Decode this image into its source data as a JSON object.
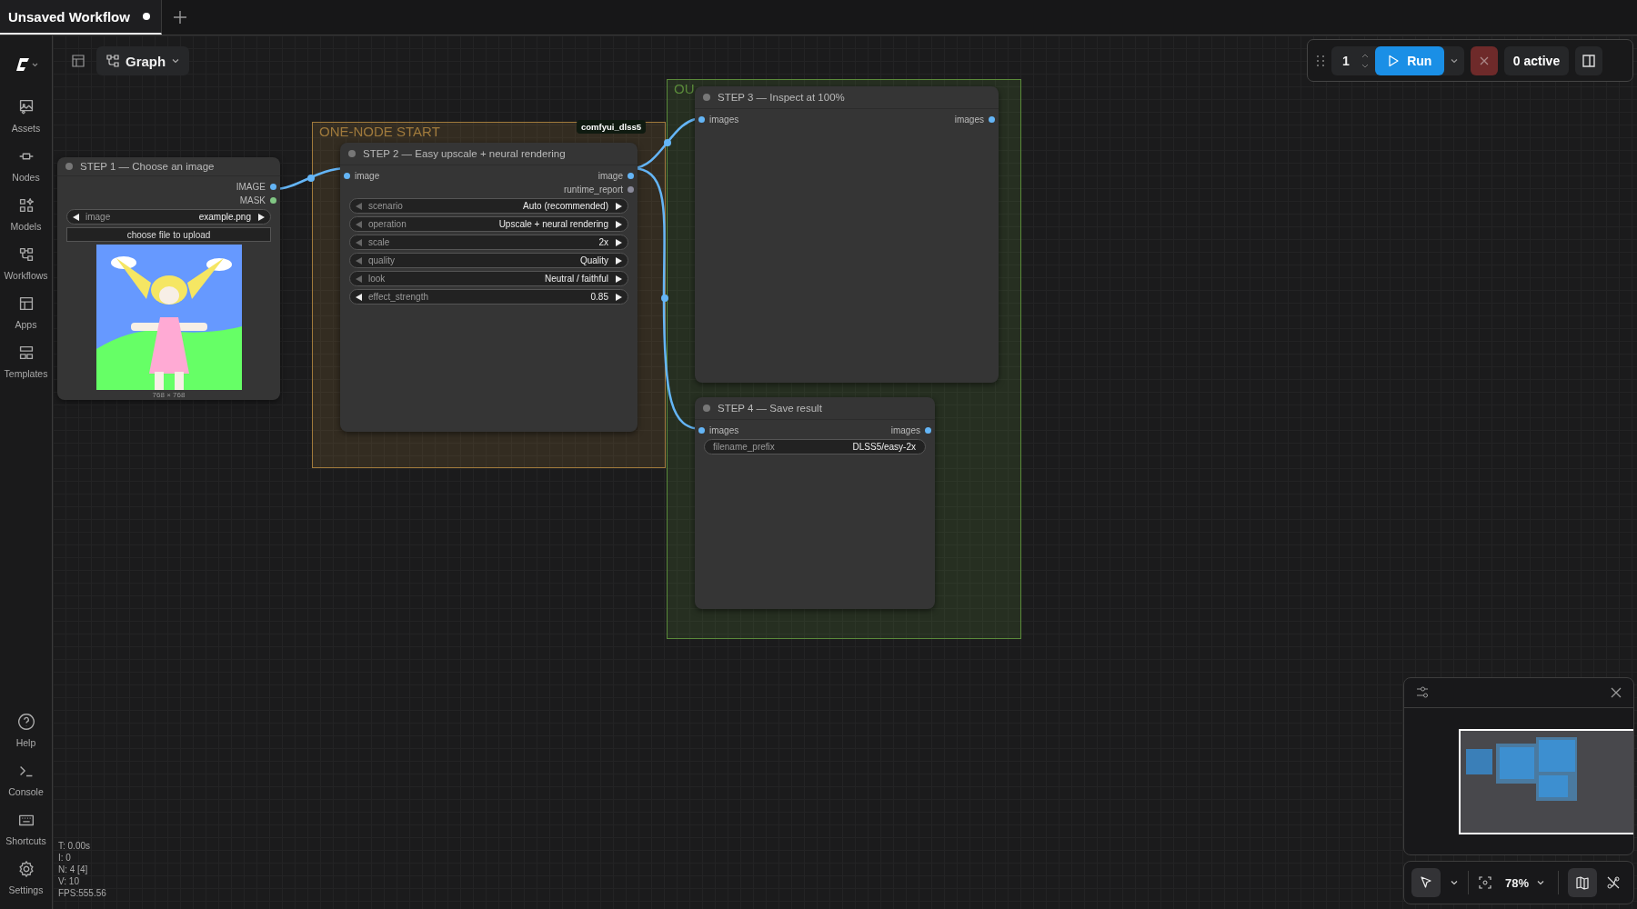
{
  "tabs": [
    {
      "label": "Unsaved Workflow",
      "selected": true,
      "modified": true
    }
  ],
  "sidebar": {
    "top": [
      {
        "label": "Assets"
      },
      {
        "label": "Nodes"
      },
      {
        "label": "Models"
      },
      {
        "label": "Workflows"
      },
      {
        "label": "Apps"
      },
      {
        "label": "Templates"
      }
    ],
    "bottom": [
      {
        "label": "Help"
      },
      {
        "label": "Console"
      },
      {
        "label": "Shortcuts"
      },
      {
        "label": "Settings"
      }
    ]
  },
  "view_button": {
    "label": "Graph"
  },
  "run_toolbar": {
    "batch_count": "1",
    "run_label": "Run",
    "active_count": "0 active"
  },
  "groups": [
    {
      "title": "ONE-NODE START",
      "color": "#a07a3c"
    },
    {
      "title": "OU",
      "color": "#5a8a3a"
    }
  ],
  "nodes": [
    {
      "title": "STEP 1 — Choose an image",
      "outputs": [
        {
          "label": "IMAGE",
          "color": "#64b5f6"
        },
        {
          "label": "MASK",
          "color": "#81c784"
        }
      ],
      "widgets": [
        {
          "kind": "combo",
          "name": "image",
          "value": "example.png",
          "prev_disabled": false
        }
      ],
      "upload_button": "choose file to upload",
      "preview": {
        "kind": "picture",
        "caption": "768 × 768"
      }
    },
    {
      "title": "STEP 2 — Easy upscale + neural rendering",
      "badge": "comfyui_dlss5",
      "inputs": [
        {
          "label": "image",
          "color": "#64b5f6"
        }
      ],
      "outputs": [
        {
          "label": "image",
          "color": "#64b5f6"
        },
        {
          "label": "runtime_report",
          "color": "#8a8a9a"
        }
      ],
      "widgets": [
        {
          "kind": "combo",
          "name": "scenario",
          "value": "Auto (recommended)",
          "prev_disabled": true
        },
        {
          "kind": "combo",
          "name": "operation",
          "value": "Upscale + neural rendering",
          "prev_disabled": true
        },
        {
          "kind": "combo",
          "name": "scale",
          "value": "2x",
          "prev_disabled": true
        },
        {
          "kind": "combo",
          "name": "quality",
          "value": "Quality",
          "prev_disabled": true
        },
        {
          "kind": "combo",
          "name": "look",
          "value": "Neutral / faithful",
          "prev_disabled": true
        },
        {
          "kind": "combo",
          "name": "effect_strength",
          "value": "0.85",
          "prev_disabled": false
        }
      ]
    },
    {
      "title": "STEP 3 — Inspect at 100%",
      "inputs": [
        {
          "label": "images",
          "color": "#64b5f6"
        }
      ],
      "outputs": [
        {
          "label": "images",
          "color": "#64b5f6"
        }
      ]
    },
    {
      "title": "STEP 4 — Save result",
      "inputs": [
        {
          "label": "images",
          "color": "#64b5f6"
        }
      ],
      "outputs": [
        {
          "label": "images",
          "color": "#64b5f6"
        }
      ],
      "widgets": [
        {
          "kind": "text",
          "name": "filename_prefix",
          "value": "DLSS5/easy-2x"
        }
      ]
    }
  ],
  "stats": [
    "T: 0.00s",
    "I: 0",
    "N: 4 [4]",
    "V: 10",
    "FPS:555.56"
  ],
  "canvas_toolbar": {
    "select_active": true,
    "zoom": "78%",
    "minimap_on": true
  }
}
